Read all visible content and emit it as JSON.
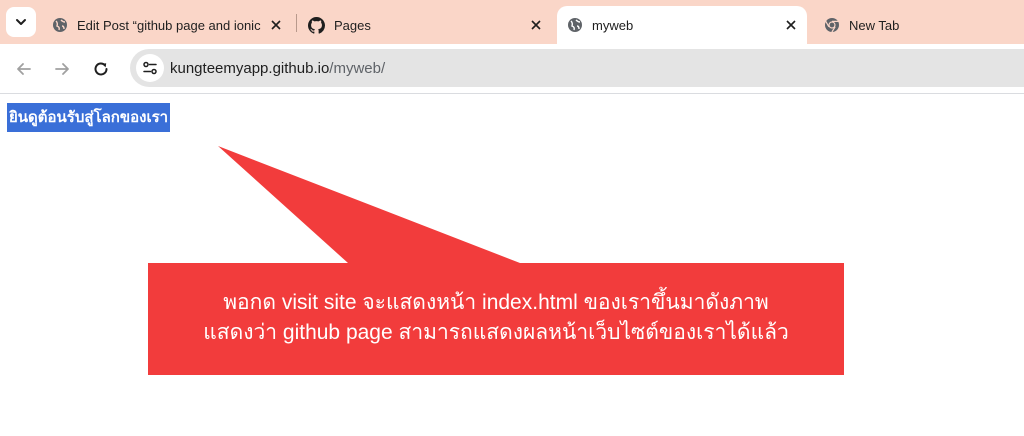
{
  "tabs": [
    {
      "title": "Edit Post “github page and ionic",
      "icon": "globe-icon",
      "active": false
    },
    {
      "title": "Pages",
      "icon": "github-icon",
      "active": false
    },
    {
      "title": "myweb",
      "icon": "globe-icon",
      "active": true
    },
    {
      "title": "New Tab",
      "icon": "chrome-icon",
      "active": false
    }
  ],
  "address_bar": {
    "host": "kungteemyapp.github.io",
    "path": "/myweb/"
  },
  "page": {
    "heading": "ยินดูต้อนรับสู่โลกของเรา"
  },
  "callout": {
    "line1": "พอกด visit site จะแสดงหน้า index.html ของเราขึ้นมาดังภาพ",
    "line2": "แสดงว่า github  page สามารถแสดงผลหน้าเว็บไซต์ของเราได้แล้ว",
    "color": "#f23c3c"
  },
  "colors": {
    "tabstrip": "#fad6c8",
    "selection": "#3a6fd8"
  }
}
